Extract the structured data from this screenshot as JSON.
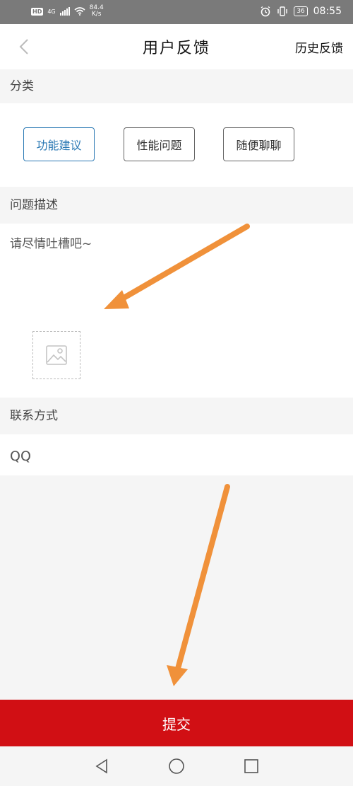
{
  "status_bar": {
    "hd_badge": "HD",
    "network": "4G",
    "speed_value": "84.4",
    "speed_unit": "K/s",
    "battery": "36",
    "time": "08:55",
    "icons": [
      "signal-icon",
      "wifi-icon",
      "alarm-icon",
      "vibrate-icon",
      "battery-icon"
    ]
  },
  "header": {
    "title": "用户反馈",
    "history_label": "历史反馈"
  },
  "category": {
    "label": "分类",
    "options": [
      "功能建议",
      "性能问题",
      "随便聊聊"
    ],
    "selected": "功能建议"
  },
  "description": {
    "label": "问题描述",
    "placeholder": "请尽情吐槽吧~"
  },
  "contact": {
    "label": "联系方式",
    "placeholder": "QQ"
  },
  "submit_label": "提交",
  "colors": {
    "accent": "#2b79b4",
    "submit_bg": "#d10f14",
    "annotation_arrow": "#f0913a"
  }
}
